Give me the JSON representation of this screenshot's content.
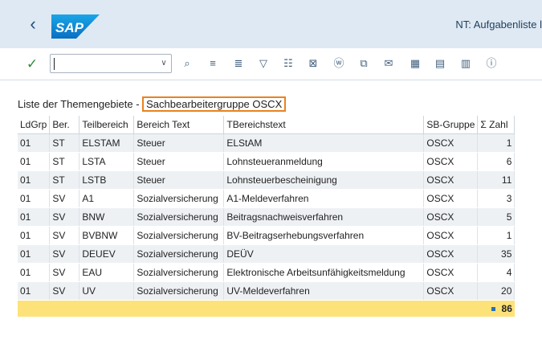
{
  "window": {
    "title": "NT: Aufgabenliste l"
  },
  "brand": {
    "logo_text": "SAP"
  },
  "toolbar": {
    "okcode_value": "",
    "icons": [
      "magnifier-icon",
      "align-center-icon",
      "align-right-icon",
      "filter-icon",
      "print-preview-icon",
      "export-excel-icon",
      "word-icon",
      "local-file-icon",
      "mail-icon",
      "spreadsheet-icon",
      "layout-change-icon",
      "layout-select-icon",
      "info-icon"
    ]
  },
  "list": {
    "title_prefix": "Liste der Themengebiete - ",
    "title_highlight": "Sachbearbeitergruppe OSCX",
    "columns": [
      "LdGrp",
      "Ber.",
      "Teilbereich",
      "Bereich Text",
      "TBereichstext",
      "SB-Gruppe",
      "Σ Zahl"
    ],
    "rows": [
      [
        "01",
        "ST",
        "ELSTAM",
        "Steuer",
        "ELStAM",
        "OSCX",
        "1"
      ],
      [
        "01",
        "ST",
        "LSTA",
        "Steuer",
        "Lohnsteueranmeldung",
        "OSCX",
        "6"
      ],
      [
        "01",
        "ST",
        "LSTB",
        "Steuer",
        "Lohnsteuerbescheinigung",
        "OSCX",
        "11"
      ],
      [
        "01",
        "SV",
        "A1",
        "Sozialversicherung",
        "A1-Meldeverfahren",
        "OSCX",
        "3"
      ],
      [
        "01",
        "SV",
        "BNW",
        "Sozialversicherung",
        "Beitragsnachweisverfahren",
        "OSCX",
        "5"
      ],
      [
        "01",
        "SV",
        "BVBNW",
        "Sozialversicherung",
        "BV-Beitragserhebungsverfahren",
        "OSCX",
        "1"
      ],
      [
        "01",
        "SV",
        "DEUEV",
        "Sozialversicherung",
        "DEÜV",
        "OSCX",
        "35"
      ],
      [
        "01",
        "SV",
        "EAU",
        "Sozialversicherung",
        "Elektronische Arbeitsunfähigkeitsmeldung",
        "OSCX",
        "4"
      ],
      [
        "01",
        "SV",
        "UV",
        "Sozialversicherung",
        "UV-Meldeverfahren",
        "OSCX",
        "20"
      ]
    ],
    "total": "86"
  },
  "colors": {
    "header_bg": "#dfe9f3",
    "sum_row": "#fde279",
    "highlight_border": "#e8831f",
    "accent": "#1d4f7c"
  }
}
